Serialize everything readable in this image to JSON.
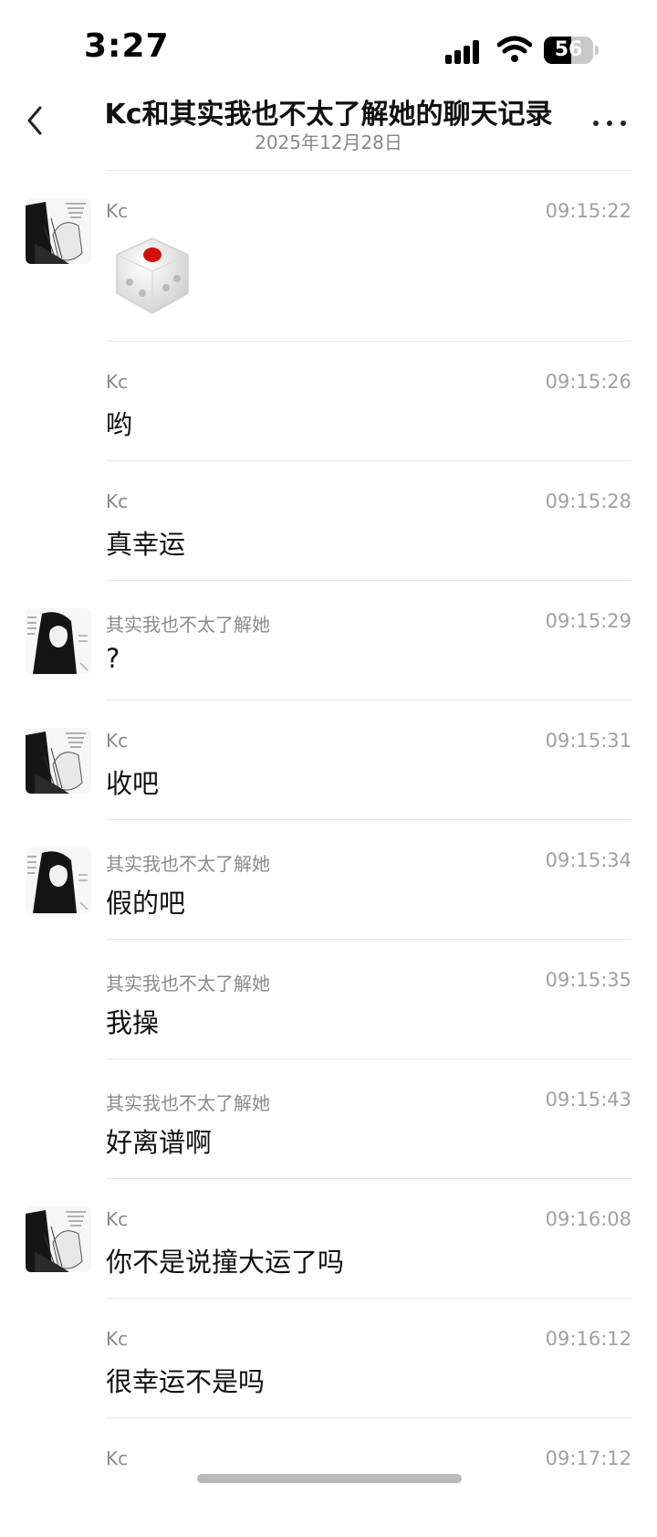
{
  "status_bar": {
    "time": "3:27",
    "battery": "56",
    "battery_level": 0.56
  },
  "header": {
    "title": "Kc和其实我也不太了解她的聊天记录",
    "date": "2025年12月28日"
  },
  "messages": [
    {
      "sender": "Kc",
      "time": "09:15:22",
      "text": "",
      "type": "dice",
      "avatar": "kc"
    },
    {
      "sender": "Kc",
      "time": "09:15:26",
      "text": "哟",
      "avatar": ""
    },
    {
      "sender": "Kc",
      "time": "09:15:28",
      "text": "真幸运",
      "avatar": ""
    },
    {
      "sender": "其实我也不太了解她",
      "time": "09:15:29",
      "text": "?",
      "avatar": "other"
    },
    {
      "sender": "Kc",
      "time": "09:15:31",
      "text": "收吧",
      "avatar": "kc"
    },
    {
      "sender": "其实我也不太了解她",
      "time": "09:15:34",
      "text": "假的吧",
      "avatar": "other"
    },
    {
      "sender": "其实我也不太了解她",
      "time": "09:15:35",
      "text": "我操",
      "avatar": ""
    },
    {
      "sender": "其实我也不太了解她",
      "time": "09:15:43",
      "text": "好离谱啊",
      "avatar": ""
    },
    {
      "sender": "Kc",
      "time": "09:16:08",
      "text": "你不是说撞大运了吗",
      "avatar": "kc"
    },
    {
      "sender": "Kc",
      "time": "09:16:12",
      "text": "很幸运不是吗",
      "avatar": ""
    },
    {
      "sender": "Kc",
      "time": "09:17:12",
      "text": "",
      "avatar": ""
    }
  ]
}
